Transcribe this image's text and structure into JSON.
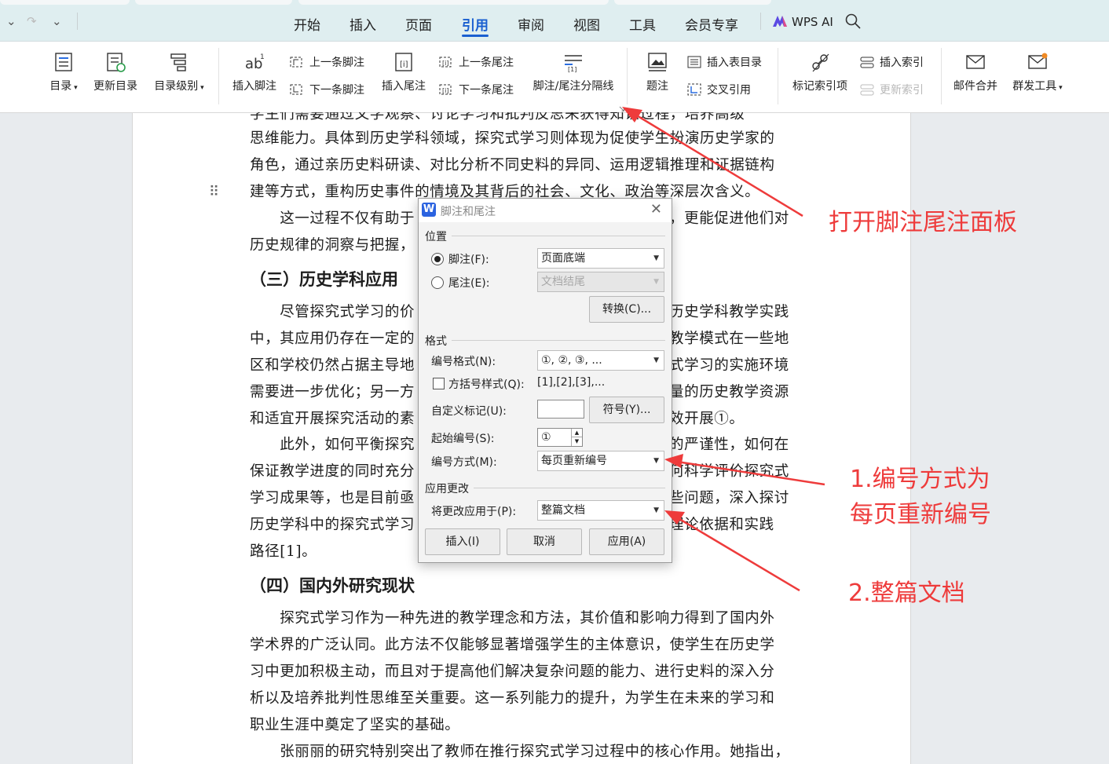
{
  "quick_access": {
    "down": "⌄",
    "redo": "↷",
    "more": "⌄"
  },
  "menu": {
    "tabs": [
      "开始",
      "插入",
      "页面",
      "引用",
      "审阅",
      "视图",
      "工具",
      "会员专享"
    ],
    "active": "引用",
    "wps_ai": "WPS AI"
  },
  "ribbon": {
    "toc": "目录",
    "update_toc": "更新目录",
    "toc_level": "目录级别",
    "insert_footnote": "插入脚注",
    "prev_footnote": "上一条脚注",
    "next_footnote": "下一条脚注",
    "insert_endnote": "插入尾注",
    "prev_endnote": "上一条尾注",
    "next_endnote": "下一条尾注",
    "separator": "脚注/尾注分隔线",
    "caption": "题注",
    "insert_table_toc": "插入表目录",
    "cross_ref": "交叉引用",
    "mark_index": "标记索引项",
    "insert_index": "插入索引",
    "update_index": "更新索引",
    "mail_merge": "邮件合并",
    "mass_send": "群发工具"
  },
  "document": {
    "top_partial": "学生们需要通过文学观察、讨论学习和批判反思来获得知识过程，培养高级",
    "p1": [
      "思维能力。具体到历史学科领域，探究式学习则体现为促使学生扮演历史学家的",
      "角色，通过亲历史料研读、对比分析不同史料的异同、运用逻辑推理和证据链构",
      "建等方式，重构历史事件的情境及其背后的社会、文化、政治等深层次含义。"
    ],
    "p2a_left": "　　这一过程不仅有助于",
    "p2a_right": "，更能促进他们对",
    "p2b_left": "历史规律的洞察与把握，",
    "h3_left": "（三）历史学科应用",
    "p3": [
      {
        "l": "　　尽管探究式学习的价",
        "r": "历史学科教学实践"
      },
      {
        "l": "中，其应用仍存在一定的",
        "r": "教学模式在一些地"
      },
      {
        "l": "区和学校仍然占据主导地",
        "r": "式学习的实施环境"
      },
      {
        "l": "需要进一步优化；另一方",
        "r": "量的历史教学资源"
      },
      {
        "l": "和适宜开展探究活动的素",
        "r": "效开展①。"
      },
      {
        "l": "　　此外，如何平衡探究",
        "r": "的严谨性，如何在"
      },
      {
        "l": "保证教学进度的同时充分",
        "r": "何科学评价探究式"
      },
      {
        "l": "学习成果等，也是目前亟",
        "r": "些问题，深入探讨"
      },
      {
        "l": "历史学科中的探究式学习",
        "r": "理论依据和实践"
      },
      {
        "l": "路径[1]。",
        "r": ""
      }
    ],
    "h4": "（四）国内外研究现状",
    "p4": [
      "　　探究式学习作为一种先进的教学理念和方法，其价值和影响力得到了国内外",
      "学术界的广泛认同。此方法不仅能够显著增强学生的主体意识，使学生在历史学",
      "习中更加积极主动，而且对于提高他们解决复杂问题的能力、进行史料的深入分",
      "析以及培养批判性思维至关重要。这一系列能力的提升，为学生在未来的学习和",
      "职业生涯中奠定了坚实的基础。",
      "　　张丽丽的研究特别突出了教师在推行探究式学习过程中的核心作用。她指出，"
    ]
  },
  "dialog": {
    "title": "脚注和尾注",
    "close": "✕",
    "position_group": "位置",
    "footnote_label": "脚注(F):",
    "footnote_value": "页面底端",
    "endnote_label": "尾注(E):",
    "endnote_value": "文档结尾",
    "convert_button": "转换(C)...",
    "format_group": "格式",
    "number_format_label": "编号格式(N):",
    "number_format_value": "①, ②, ③, ...",
    "bracket_label": "方括号样式(Q):",
    "bracket_value": "[1],[2],[3],...",
    "custom_mark_label": "自定义标记(U):",
    "custom_mark_value": "",
    "symbol_button": "符号(Y)...",
    "start_label": "起始编号(S):",
    "start_value": "①",
    "numbering_label": "编号方式(M):",
    "numbering_value": "每页重新编号",
    "apply_group": "应用更改",
    "apply_to_label": "将更改应用于(P):",
    "apply_to_value": "整篇文档",
    "insert_button": "插入(I)",
    "cancel_button": "取消",
    "apply_button": "应用(A)"
  },
  "annotations": {
    "open_panel": "打开脚注尾注面板",
    "step1_line1": "1.编号方式为",
    "step1_line2": "每页重新编号",
    "step2": "2.整篇文档"
  },
  "colors": {
    "accent": "#1a5fd0",
    "annotation": "#ee3b3b",
    "menubar": "#dfeef0"
  }
}
